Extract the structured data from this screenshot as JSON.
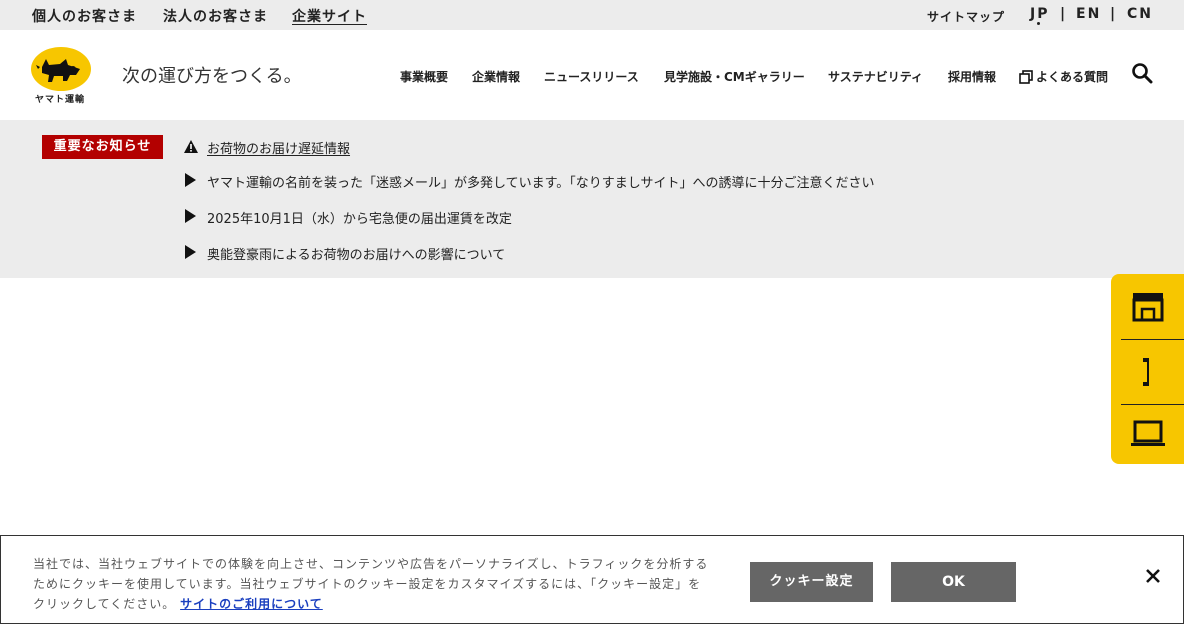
{
  "topbar": {
    "personal": "個人のお客さま",
    "business": "法人のお客さま",
    "corporate": "企業サイト",
    "sitemap": "サイトマップ",
    "languages": [
      "JP",
      "EN",
      "CN"
    ],
    "separator": "|"
  },
  "header": {
    "logo_text": "ヤマト運輸",
    "tagline": "次の運び方をつくる。",
    "nav": [
      "事業概要",
      "企業情報",
      "ニュースリリース",
      "見学施設・CMギャラリー",
      "サステナビリティ",
      "採用情報",
      "よくある質問"
    ]
  },
  "notice": {
    "badge": "重要なお知らせ",
    "alert_link": "お荷物のお届け遅延情報",
    "items": [
      "ヤマト運輸の名前を装った「迷惑メール」が多発しています。「なりすましサイト」への誘導に十分ご注意ください",
      "2025年10月1日（水）から宅急便の届出運賃を改定",
      "奥能登豪雨によるお荷物のお届けへの影響について"
    ]
  },
  "sidewidget": {
    "icons": [
      "store-icon",
      "phone-icon",
      "laptop-icon"
    ]
  },
  "cookie": {
    "line1": "当社では、当社ウェブサイトでの体験を向上させ、コンテンツや広告をパーソナライズし、トラフィックを分析する",
    "line2": "ためにクッキーを使用しています。当社ウェブサイトのクッキー設定をカスタマイズするには、「クッキー設定」を",
    "line3": "クリックしてください。",
    "link": "サイトのご利用について",
    "settings_button": "クッキー設定",
    "ok_button": "OK"
  },
  "colors": {
    "brand_yellow": "#f7c600",
    "notice_red": "#b30000",
    "gray_bg": "#ececec",
    "button_gray": "#666666"
  }
}
